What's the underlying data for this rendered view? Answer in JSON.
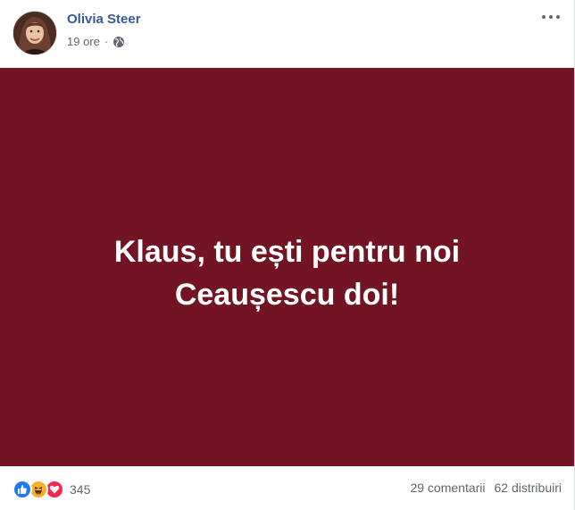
{
  "post": {
    "author": "Olivia Steer",
    "time": "19 ore",
    "separator": "·",
    "privacy_icon": "globe-icon",
    "menu_icon": "more-options-icon",
    "image_text_line1": "Klaus, tu ești pentru noi",
    "image_text_line2": "Ceaușescu doi!",
    "image_bg_color": "#731424"
  },
  "footer": {
    "reaction_icons": [
      "like-icon",
      "haha-icon",
      "love-icon"
    ],
    "reaction_count": "345",
    "comments": "29 comentarii",
    "shares": "62 distribuiri"
  },
  "colors": {
    "author": "#385898",
    "meta": "#606770",
    "like": "#2078f4",
    "haha": "#f7b125",
    "love": "#f0284a"
  }
}
